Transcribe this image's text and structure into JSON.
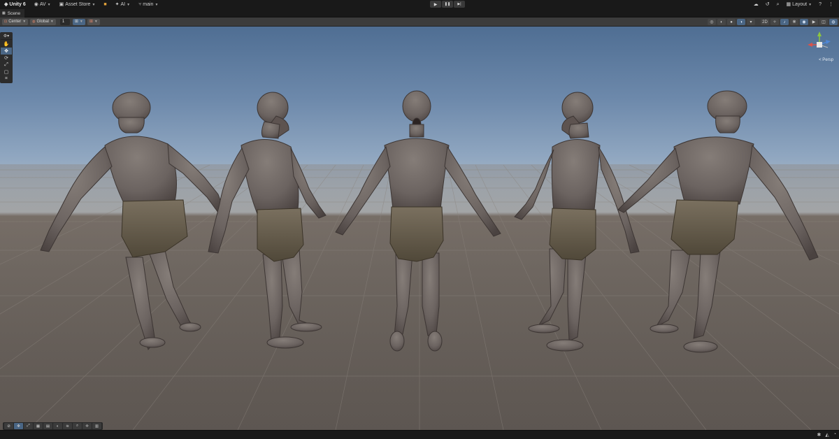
{
  "topbar": {
    "brand": "Unity 6",
    "account": "AV",
    "asset_store": "Asset Store",
    "ai": "AI",
    "branch": "main",
    "layout": "Layout"
  },
  "playback": {
    "play_icon": "▶",
    "pause_icon": "❚❚",
    "step_icon": "▶|"
  },
  "tabs": {
    "scene": "Scene"
  },
  "scene_toolbar": {
    "pivot": "Center",
    "space": "Global",
    "snap_increment": "1"
  },
  "tools": [
    {
      "name": "view-tool",
      "glyph": "✋"
    },
    {
      "name": "move-tool",
      "glyph": "✥"
    },
    {
      "name": "rotate-tool",
      "glyph": "⟳"
    },
    {
      "name": "scale-tool",
      "glyph": "⤢"
    },
    {
      "name": "rect-tool",
      "glyph": "▢"
    },
    {
      "name": "transform-tool",
      "glyph": "⌗"
    }
  ],
  "gizmo": {
    "label": "< Persp",
    "axis_y": "y",
    "axis_x": "x",
    "axis_z": "z"
  },
  "colors": {
    "accent": "#4a6685",
    "axis_x": "#d9534a",
    "axis_y": "#8dc63f",
    "axis_z": "#4f87d6",
    "skin": "#6e6662",
    "cloth": "#6b6152"
  }
}
